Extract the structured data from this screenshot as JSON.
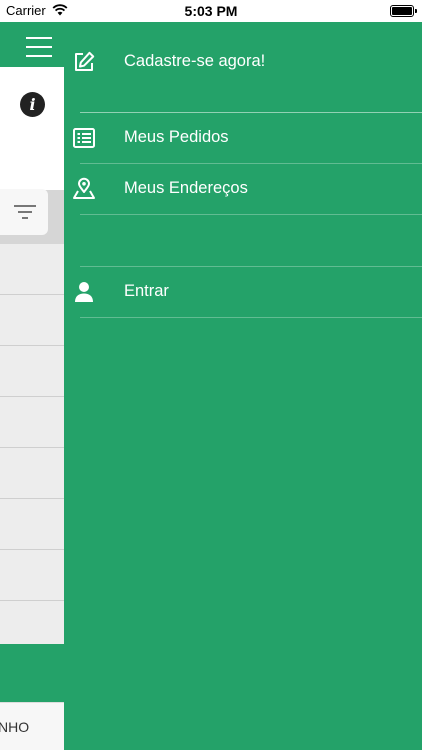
{
  "status_bar": {
    "carrier": "Carrier",
    "time": "5:03 PM"
  },
  "background_screen": {
    "footer_text": "NHO"
  },
  "drawer": {
    "background_color": "#24a269",
    "items": [
      {
        "label": "Cadastre-se agora!",
        "icon": "edit-icon"
      },
      {
        "label": "Meus Pedidos",
        "icon": "list-icon"
      },
      {
        "label": "Meus Endereços",
        "icon": "map-pin-icon"
      },
      {
        "label": "",
        "icon": ""
      },
      {
        "label": "Entrar",
        "icon": "user-icon"
      }
    ]
  }
}
